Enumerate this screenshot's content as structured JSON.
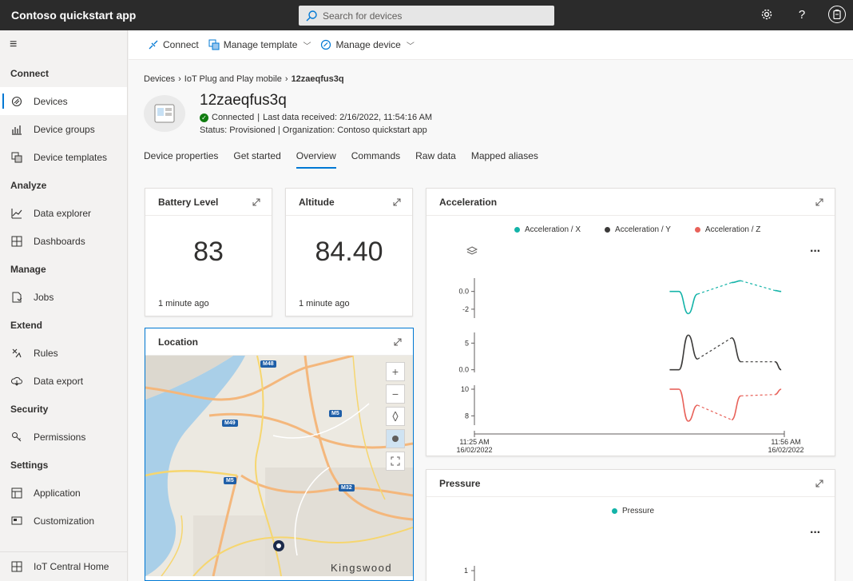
{
  "app": {
    "title": "Contoso quickstart app"
  },
  "search": {
    "placeholder": "Search for devices"
  },
  "topbar_icons": [
    "settings-icon",
    "help-icon",
    "account-icon"
  ],
  "sidebar": {
    "sections": [
      {
        "header": "Connect",
        "items": [
          {
            "label": "Devices",
            "icon": "devices-icon",
            "active": true
          },
          {
            "label": "Device groups",
            "icon": "device-groups-icon"
          },
          {
            "label": "Device templates",
            "icon": "device-templates-icon"
          }
        ]
      },
      {
        "header": "Analyze",
        "items": [
          {
            "label": "Data explorer",
            "icon": "data-explorer-icon"
          },
          {
            "label": "Dashboards",
            "icon": "dashboards-icon"
          }
        ]
      },
      {
        "header": "Manage",
        "items": [
          {
            "label": "Jobs",
            "icon": "jobs-icon"
          }
        ]
      },
      {
        "header": "Extend",
        "items": [
          {
            "label": "Rules",
            "icon": "rules-icon"
          },
          {
            "label": "Data export",
            "icon": "data-export-icon"
          }
        ]
      },
      {
        "header": "Security",
        "items": [
          {
            "label": "Permissions",
            "icon": "permissions-icon"
          }
        ]
      },
      {
        "header": "Settings",
        "items": [
          {
            "label": "Application",
            "icon": "application-icon"
          },
          {
            "label": "Customization",
            "icon": "customization-icon"
          }
        ]
      }
    ],
    "bottom": {
      "label": "IoT Central Home",
      "icon": "home-icon"
    }
  },
  "cmdbar": {
    "connect": "Connect",
    "manage_template": "Manage template",
    "manage_device": "Manage device"
  },
  "breadcrumb": {
    "devices": "Devices",
    "template": "IoT Plug and Play mobile",
    "current": "12zaeqfus3q"
  },
  "device": {
    "name": "12zaeqfus3q",
    "connection": "Connected",
    "last_data": "Last data received: 2/16/2022, 11:54:16 AM",
    "status": "Status: Provisioned",
    "organization": "Organization: Contoso quickstart app"
  },
  "tabs": [
    "Device properties",
    "Get started",
    "Overview",
    "Commands",
    "Raw data",
    "Mapped aliases"
  ],
  "active_tab": "Overview",
  "tiles": {
    "battery": {
      "title": "Battery Level",
      "value": "83",
      "time": "1 minute ago"
    },
    "altitude": {
      "title": "Altitude",
      "value": "84.40",
      "time": "1 minute ago"
    },
    "location": {
      "title": "Location"
    },
    "acceleration": {
      "title": "Acceleration"
    },
    "pressure": {
      "title": "Pressure"
    }
  },
  "map": {
    "road_labels": [
      "M48",
      "M49",
      "M5",
      "M5",
      "M32"
    ],
    "place_label": "Kingswood"
  },
  "colors": {
    "accent": "#0078d4",
    "teal": "#13b3a8",
    "dark": "#3b3a39",
    "red": "#e8625a",
    "connected": "#107c10"
  },
  "chart_data": [
    {
      "type": "line",
      "title": "Acceleration",
      "x_ticks": [
        "11:25 AM 16/02/2022",
        "11:56 AM 16/02/2022"
      ],
      "series": [
        {
          "name": "Acceleration / X",
          "color": "#13b3a8",
          "y_ticks": [
            "0.0",
            "-2"
          ],
          "x": [
            "11:50",
            "11:51",
            "11:51:30",
            "11:52",
            "11:53",
            "11:54",
            "11:55",
            "11:56"
          ],
          "values": [
            0.0,
            0.0,
            -2.5,
            -0.3,
            1.0,
            1.2,
            0.1,
            0.0
          ]
        },
        {
          "name": "Acceleration / Y",
          "color": "#3b3a39",
          "y_ticks": [
            "5",
            "0.0"
          ],
          "x": [
            "11:50",
            "11:51",
            "11:51:30",
            "11:52",
            "11:53",
            "11:54",
            "11:55",
            "11:56"
          ],
          "values": [
            0.0,
            0.0,
            6.5,
            2.0,
            6.0,
            1.5,
            1.5,
            0.0
          ]
        },
        {
          "name": "Acceleration / Z",
          "color": "#e8625a",
          "y_ticks": [
            "10",
            "8"
          ],
          "x": [
            "11:50",
            "11:51",
            "11:51:30",
            "11:52",
            "11:53",
            "11:54",
            "11:55",
            "11:56"
          ],
          "values": [
            10.0,
            10.0,
            7.6,
            8.8,
            7.7,
            9.5,
            9.6,
            10.0
          ]
        }
      ]
    },
    {
      "type": "line",
      "title": "Pressure",
      "series": [
        {
          "name": "Pressure",
          "color": "#13b3a8",
          "y_ticks": [
            "1"
          ],
          "values": []
        }
      ]
    }
  ]
}
